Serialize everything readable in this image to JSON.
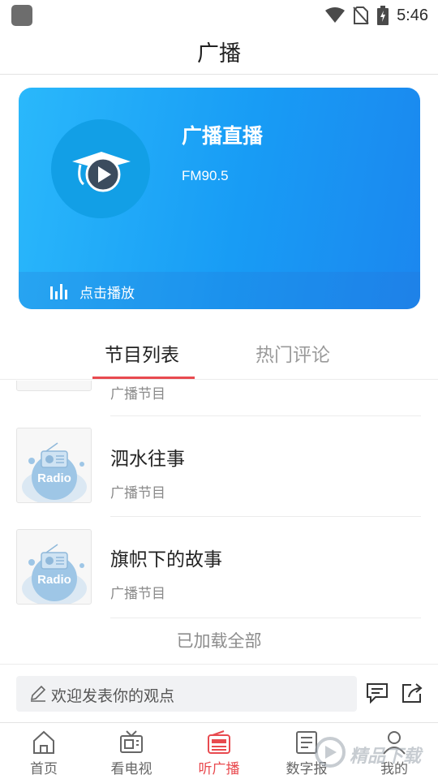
{
  "status_bar": {
    "time": "5:46"
  },
  "header": {
    "title": "广播"
  },
  "live": {
    "title": "广播直播",
    "frequency": "FM90.5",
    "play_label": "点击播放"
  },
  "tabs": [
    {
      "label": "节目列表",
      "active": true
    },
    {
      "label": "热门评论",
      "active": false
    }
  ],
  "programs": [
    {
      "title": "",
      "subtitle": "广播节目",
      "thumb_text": "Radio"
    },
    {
      "title": "泗水往事",
      "subtitle": "广播节目",
      "thumb_text": "Radio"
    },
    {
      "title": "旗帜下的故事",
      "subtitle": "广播节目",
      "thumb_text": "Radio"
    }
  ],
  "list_footer": "已加载全部",
  "comment": {
    "placeholder": "欢迎发表你的观点"
  },
  "bottom_nav": [
    {
      "label": "首页",
      "icon": "home-icon",
      "active": false
    },
    {
      "label": "看电视",
      "icon": "tv-icon",
      "active": false
    },
    {
      "label": "听广播",
      "icon": "radio-icon",
      "active": true
    },
    {
      "label": "数字报",
      "icon": "newspaper-icon",
      "active": false
    },
    {
      "label": "我的",
      "icon": "profile-icon",
      "active": false
    }
  ],
  "watermark": {
    "text": "精品下载"
  },
  "colors": {
    "accent": "#e84a4f",
    "card_blue": "#189cf5",
    "text_primary": "#222222",
    "text_secondary": "#8a8a8a"
  }
}
